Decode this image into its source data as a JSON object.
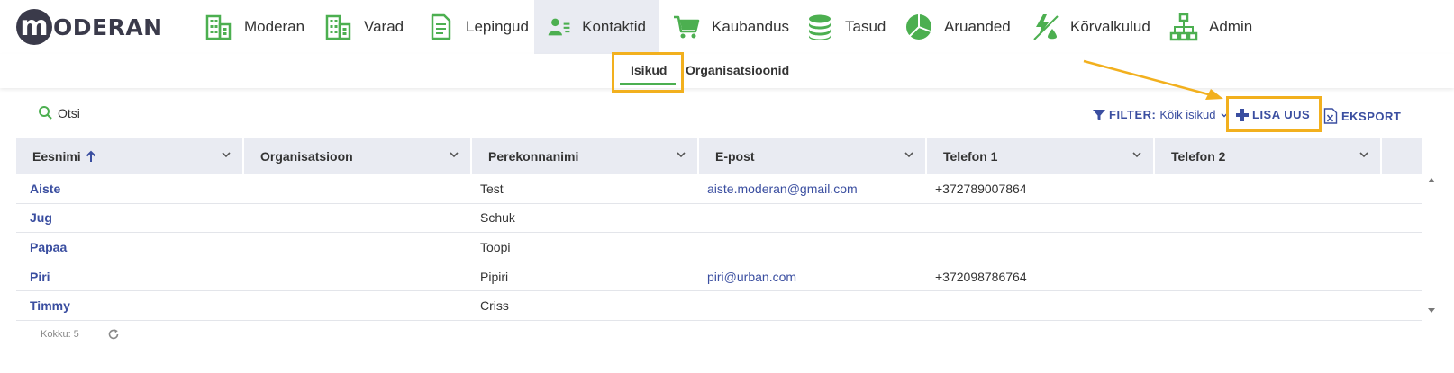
{
  "logo": {
    "mark": "m",
    "text": "ODERAN"
  },
  "nav": [
    {
      "label": "Moderan",
      "icon": "building-icon"
    },
    {
      "label": "Varad",
      "icon": "building-icon"
    },
    {
      "label": "Lepingud",
      "icon": "document-icon"
    },
    {
      "label": "Kontaktid",
      "icon": "contacts-icon",
      "active": true
    },
    {
      "label": "Kaubandus",
      "icon": "cart-icon"
    },
    {
      "label": "Tasud",
      "icon": "coins-icon"
    },
    {
      "label": "Aruanded",
      "icon": "pie-chart-icon"
    },
    {
      "label": "Kõrvalkulud",
      "icon": "utility-icon"
    },
    {
      "label": "Admin",
      "icon": "org-chart-icon"
    }
  ],
  "subtabs": [
    {
      "label": "Isikud",
      "active": true
    },
    {
      "label": "Organisatsioonid",
      "active": false
    }
  ],
  "toolbar": {
    "search_label": "Otsi",
    "filter_label": "FILTER:",
    "filter_value": "Kõik isikud",
    "add_label": "LISA UUS",
    "export_label": "EKSPORT"
  },
  "table": {
    "columns": [
      "Eesnimi",
      "Organisatsioon",
      "Perekonnanimi",
      "E-post",
      "Telefon 1",
      "Telefon 2"
    ],
    "sort_column": "Eesnimi",
    "rows": [
      {
        "first": "Aiste",
        "org": "",
        "last": "Test",
        "email": "aiste.moderan@gmail.com",
        "phone1": "+372789007864",
        "phone2": ""
      },
      {
        "first": "Jug",
        "org": "",
        "last": "Schuk",
        "email": "",
        "phone1": "",
        "phone2": ""
      },
      {
        "first": "Papaa",
        "org": "",
        "last": "Toopi",
        "email": "",
        "phone1": "",
        "phone2": ""
      },
      {
        "first": "Piri",
        "org": "",
        "last": "Pipiri",
        "email": "piri@urban.com",
        "phone1": "+372098786764",
        "phone2": ""
      },
      {
        "first": "Timmy",
        "org": "",
        "last": "Criss",
        "email": "",
        "phone1": "",
        "phone2": ""
      }
    ]
  },
  "footer": {
    "count_label": "Kokku: 5"
  },
  "colors": {
    "accent_green": "#4caf50",
    "link_blue": "#3a4ea0",
    "highlight": "#f2b01e",
    "header_bg": "#e9ebf2"
  }
}
